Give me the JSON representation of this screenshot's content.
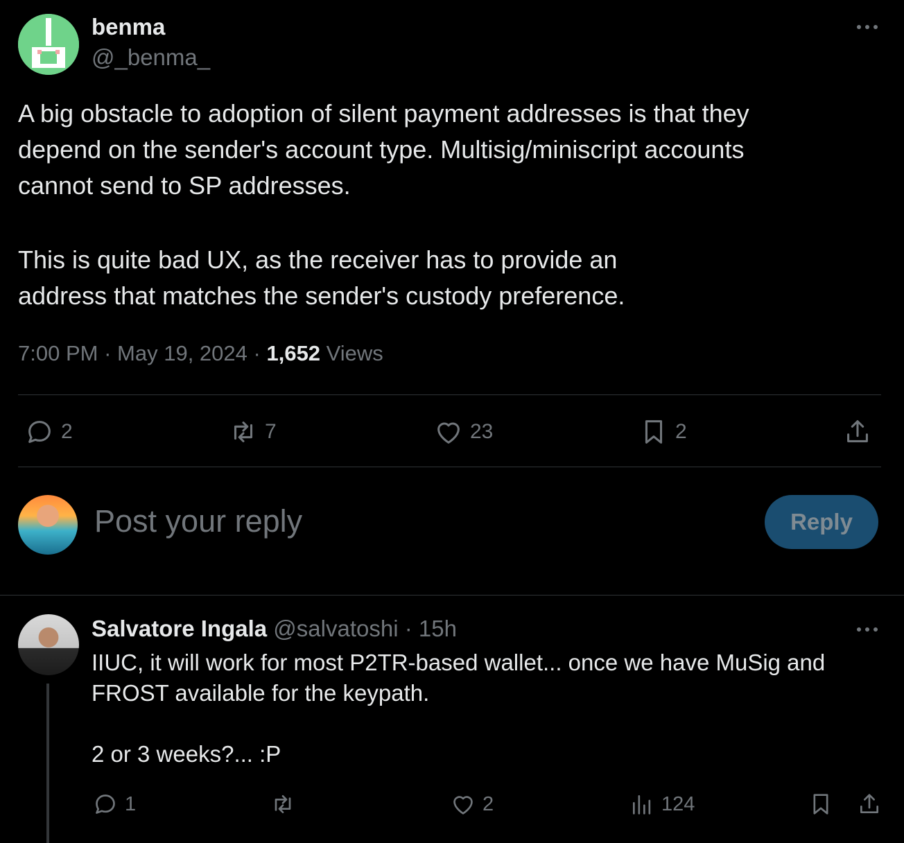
{
  "tweet": {
    "author_name": "benma",
    "author_handle": "@_benma_",
    "text_p1": "A big obstacle to adoption of silent payment addresses is that they\ndepend on the sender's account type. Multisig/miniscript accounts\ncannot send to SP addresses.",
    "text_p2": "This is quite bad UX, as the receiver has to provide an\naddress that matches the sender's custody preference.",
    "time": "7:00 PM",
    "date": "May 19, 2024",
    "views_count": "1,652",
    "views_label": "Views",
    "sep": "·",
    "stats": {
      "replies": "2",
      "reposts": "7",
      "likes": "23",
      "bookmarks": "2"
    }
  },
  "compose": {
    "placeholder": "Post your reply",
    "button_label": "Reply"
  },
  "reply": {
    "author_name": "Salvatore Ingala",
    "author_handle": "@salvatoshi",
    "sep": "·",
    "age": "15h",
    "text_p1": "IIUC, it will work for most P2TR-based wallet... once we have MuSig and\nFROST available for the keypath.",
    "text_p2": "2 or 3 weeks?... :P",
    "stats": {
      "replies": "1",
      "likes": "2",
      "views": "124"
    }
  },
  "icons": {
    "reply": "speech-bubble-icon",
    "repost": "repost-arrows-icon",
    "like": "heart-icon",
    "bookmark": "bookmark-icon",
    "share": "share-upload-icon",
    "views": "bar-chart-icon",
    "more": "ellipsis-icon"
  },
  "colors": {
    "background": "#000000",
    "text": "#e7e9ea",
    "muted": "#71767b",
    "divider": "#2f3336",
    "reply_button_bg": "#1a4d70"
  }
}
